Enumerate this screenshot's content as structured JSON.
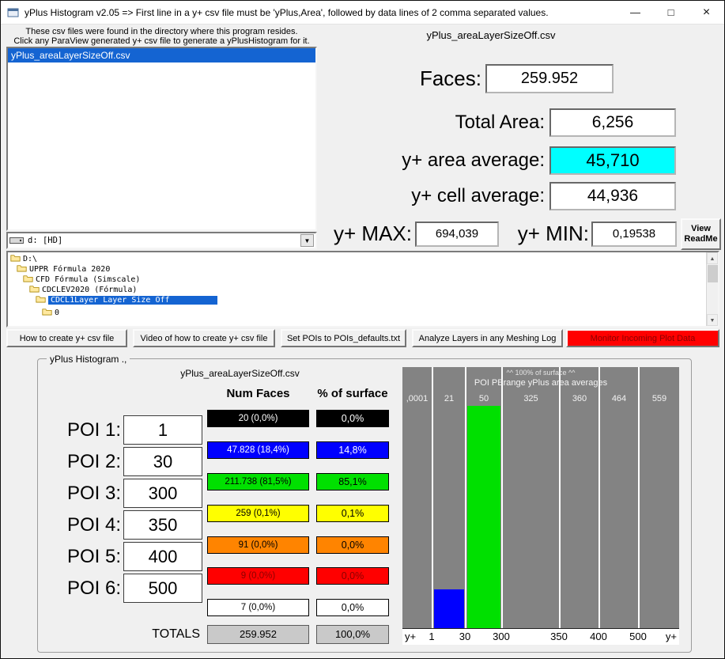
{
  "window": {
    "title": "yPlus Histogram v2.05 => First line in a y+ csv file must be 'yPlus,Area', followed by data lines of 2 comma separated values.",
    "minimize_glyph": "—",
    "maximize_glyph": "□",
    "close_glyph": "×"
  },
  "icons": {
    "dropdown_glyph": "▼",
    "scroll_up_glyph": "▲",
    "scroll_down_glyph": "▼"
  },
  "colors": {
    "selection": "#1464d2",
    "value_highlight_bg": "#00ffff",
    "monitor_button_bg": "#ff0000",
    "monitor_button_fg": "#8b0000",
    "chart_bg": "#838383",
    "totals_bg": "#c9c9c9"
  },
  "file_browser": {
    "instructions_line1": "These csv files were found in the directory where this program resides.",
    "instructions_line2": "Click any ParaView generated y+ csv file to generate a yPlusHistogram for it.",
    "files": [
      {
        "label": "yPlus_areaLayerSizeOff.csv"
      }
    ],
    "drive_selector": {
      "value": "d:  [HD]"
    },
    "directories": [
      {
        "label": "D:\\"
      },
      {
        "label": "UPPR Fórmula 2020"
      },
      {
        "label": "CFD Fórmula (Simscale)"
      },
      {
        "label": "CDCLEV2020 (Fórmula)"
      },
      {
        "label": "CDCL1Layer Layer Size Off"
      },
      {
        "label": "0"
      }
    ]
  },
  "summary": {
    "csv_title": "yPlus_areaLayerSizeOff.csv",
    "faces_label": "Faces:",
    "faces_value": "259.952",
    "total_area_label": "Total Area:",
    "total_area_value": "6,256",
    "area_avg_label": "y+ area average:",
    "area_avg_value": "45,710",
    "cell_avg_label": "y+ cell average:",
    "cell_avg_value": "44,936",
    "ymax_label": "y+ MAX:",
    "ymax_value": "694,039",
    "ymin_label": "y+ MIN:",
    "ymin_value": "0,19538",
    "readme_line1": "View",
    "readme_line2": "ReadMe"
  },
  "toolbar": {
    "how_to": "How to create y+ csv file",
    "video": "Video of how to create y+ csv file",
    "set_pois": "Set POIs to POIs_defaults.txt",
    "analyze": "Analyze Layers in any Meshing Log",
    "monitor": "Monitor Incoming Plot Data"
  },
  "histogram_panel": {
    "group_title": "yPlus Histogram .,",
    "csv_label": "yPlus_areaLayerSizeOff.csv",
    "num_faces_header": "Num Faces",
    "pct_header": "% of surface",
    "pois": [
      {
        "label": "POI 1:",
        "value": "1"
      },
      {
        "label": "POI 2:",
        "value": "30"
      },
      {
        "label": "POI 3:",
        "value": "300"
      },
      {
        "label": "POI 4:",
        "value": "350"
      },
      {
        "label": "POI 5:",
        "value": "400"
      },
      {
        "label": "POI 6:",
        "value": "500"
      }
    ],
    "bins": [
      {
        "num_faces": "20 (0,0%)",
        "pct": "0,0%",
        "bg": "#000000",
        "fg": "#ffffff"
      },
      {
        "num_faces": "47.828 (18,4%)",
        "pct": "14,8%",
        "bg": "#0000ff",
        "fg": "#ffffff"
      },
      {
        "num_faces": "211.738 (81,5%)",
        "pct": "85,1%",
        "bg": "#00e000",
        "fg": "#000000"
      },
      {
        "num_faces": "259 (0,1%)",
        "pct": "0,1%",
        "bg": "#ffff00",
        "fg": "#000000"
      },
      {
        "num_faces": "91 (0,0%)",
        "pct": "0,0%",
        "bg": "#ff8400",
        "fg": "#000000"
      },
      {
        "num_faces": "9 (0,0%)",
        "pct": "0,0%",
        "bg": "#ff0000",
        "fg": "#8b0000"
      },
      {
        "num_faces": "7 (0,0%)",
        "pct": "0,0%",
        "bg": "#ffffff",
        "fg": "#000000"
      }
    ],
    "totals_label": "TOTALS",
    "totals_num_faces": "259.952",
    "totals_pct": "100,0%"
  },
  "chart_data": {
    "type": "bar",
    "title": "^^ 100% of surface ^^",
    "subtitle": "POI PErange yPlus area averages",
    "bin_avg_labels": [
      ",0001",
      "21",
      "50",
      "325",
      "360",
      "464",
      "559"
    ],
    "series": [
      {
        "name": "% of surface",
        "values": [
          0.0,
          14.8,
          85.1,
          0.1,
          0.0,
          0.0,
          0.0
        ]
      }
    ],
    "bar_colors": [
      "#000000",
      "#0000ff",
      "#00e000",
      "#ffff00",
      "#ff8400",
      "#ff0000",
      "#ffffff"
    ],
    "x_tick_labels": [
      "y+",
      "1",
      "30",
      "300",
      "350",
      "400",
      "500",
      "y+"
    ],
    "ylabel": "% of surface",
    "ylim": [
      0,
      100
    ],
    "grid": false,
    "legend": false
  }
}
